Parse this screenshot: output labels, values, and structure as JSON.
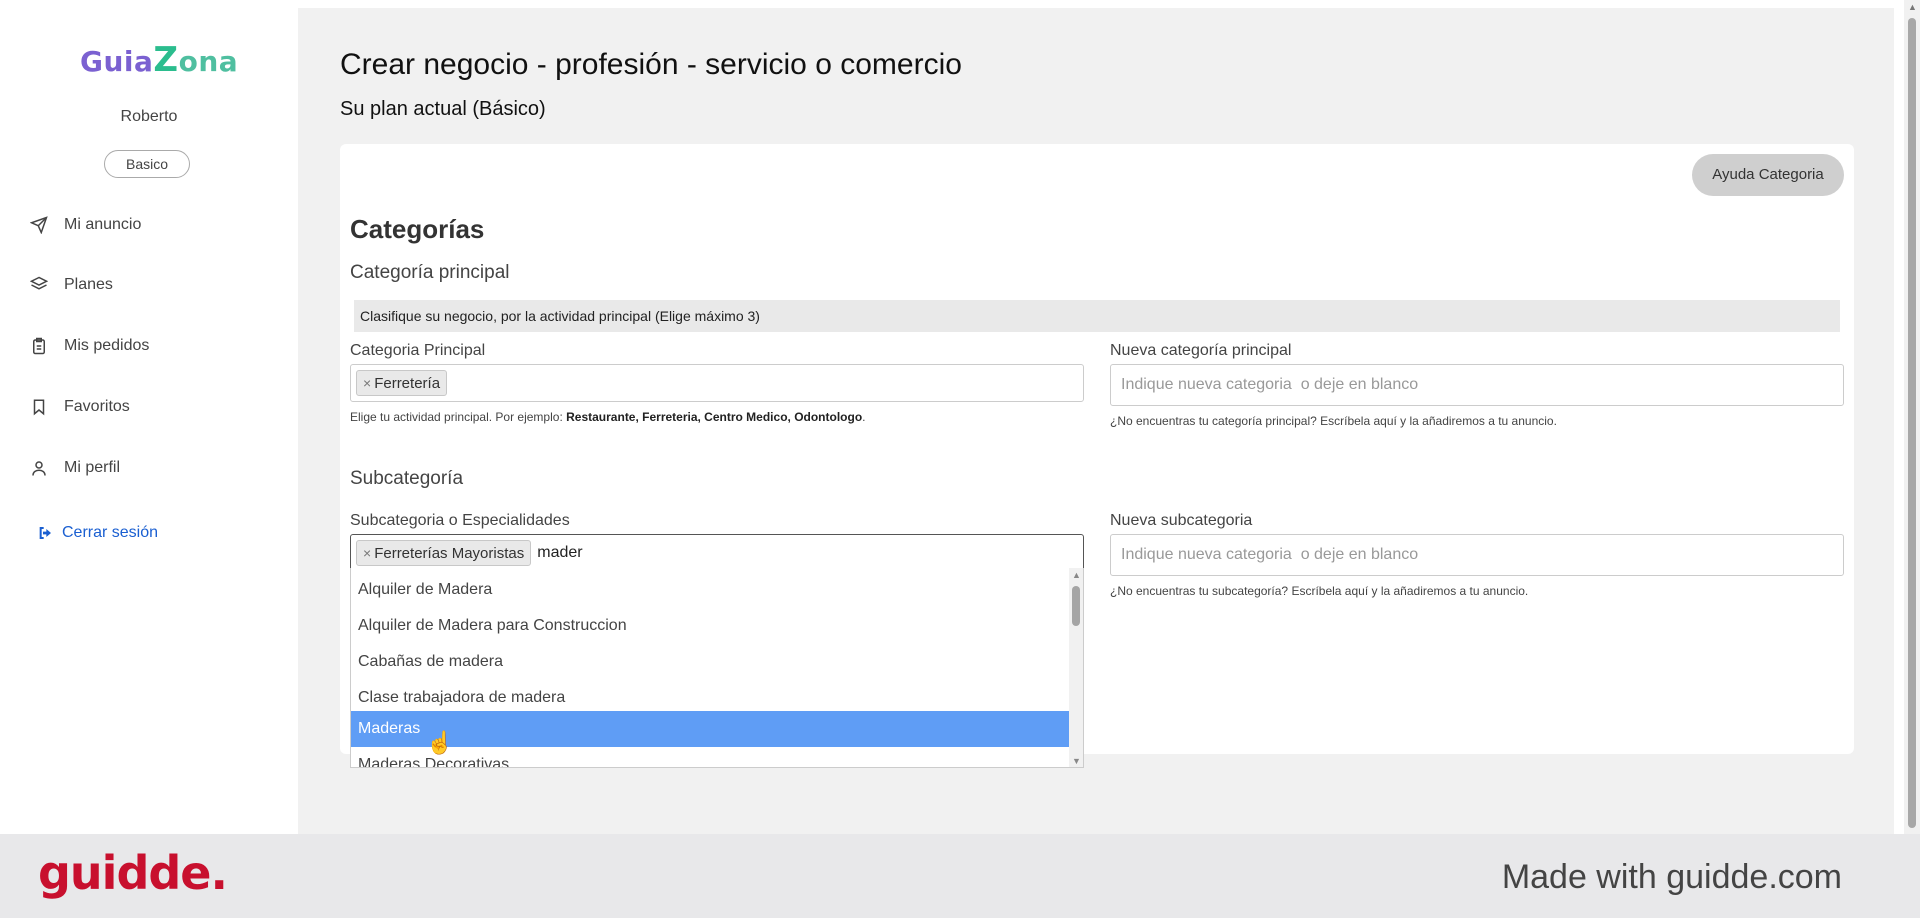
{
  "sidebar": {
    "logo": {
      "part1": "Guia",
      "z": "Z",
      "part2": "ona"
    },
    "username": "Roberto",
    "plan_badge": "Basico",
    "items": [
      {
        "label": "Mi anuncio",
        "icon": "send-icon"
      },
      {
        "label": "Planes",
        "icon": "layers-icon"
      },
      {
        "label": "Mis pedidos",
        "icon": "clipboard-icon"
      },
      {
        "label": "Favoritos",
        "icon": "bookmark-icon"
      },
      {
        "label": "Mi perfil",
        "icon": "user-icon"
      }
    ],
    "logout_label": "Cerrar sesión"
  },
  "main": {
    "title": "Crear negocio - profesión - servicio o comercio",
    "plan_line": "Su plan actual (Básico)",
    "help_button": "Ayuda Categoria",
    "section_title": "Categorías",
    "main_category": {
      "subtitle": "Categoría principal",
      "info": "Clasifique su negocio, por la actividad principal (Elige máximo 3)",
      "label": "Categoria Principal",
      "chip": "Ferretería",
      "help_prefix": "Elige tu actividad principal. Por ejemplo: ",
      "help_examples": "Restaurante, Ferreteria, Centro Medico, Odontologo",
      "help_suffix": ".",
      "new_label": "Nueva categoría principal",
      "new_placeholder": "Indique nueva categoria  o deje en blanco",
      "new_help": "¿No encuentras tu categoría principal? Escríbela aquí y la añadiremos a tu anuncio."
    },
    "subcategory": {
      "subtitle": "Subcategoría",
      "label": "Subcategoria o Especialidades",
      "chip": "Ferreterías Mayoristas",
      "typed": "mader",
      "new_label": "Nueva subcategoria",
      "new_placeholder": "Indique nueva categoria  o deje en blanco",
      "new_help": "¿No encuentras tu subcategoría? Escríbela aquí y la añadiremos a tu anuncio.",
      "options": [
        "Alquiler de Madera",
        "Alquiler de Madera para Construccion",
        "Cabañas de madera",
        "Clase trabajadora de madera",
        "Maderas",
        "Maderas Decorativas"
      ],
      "active_option": "Maderas"
    }
  },
  "footer": {
    "brand": "guidde.",
    "made_with": "Made with guidde.com"
  },
  "colors": {
    "accent_blue": "#1a5fd1",
    "highlight": "#5f9df5",
    "brand_red": "#c8102e"
  }
}
